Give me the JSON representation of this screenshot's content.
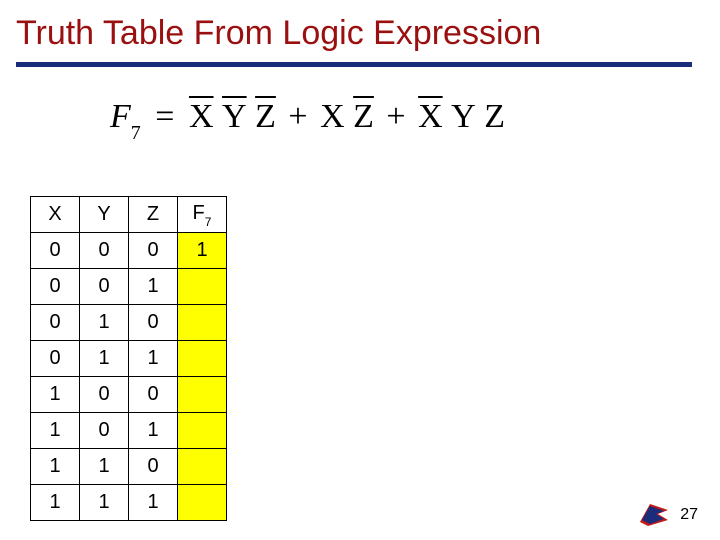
{
  "title": "Truth Table From Logic Expression",
  "equation": {
    "lhs_var": "F",
    "lhs_sub": "7",
    "eq": "=",
    "t1_a": "X",
    "t1_b": "Y",
    "t1_c": "Z",
    "plus1": "+",
    "t2_a": "X",
    "t2_b": "Z",
    "plus2": "+",
    "t3_a": "X",
    "t3_b": "Y",
    "t3_c": "Z"
  },
  "table": {
    "headers": {
      "c1": "X",
      "c2": "Y",
      "c3": "Z",
      "c4a": "F",
      "c4b": "7"
    },
    "rows": [
      {
        "x": "0",
        "y": "0",
        "z": "0",
        "f": "1"
      },
      {
        "x": "0",
        "y": "0",
        "z": "1",
        "f": ""
      },
      {
        "x": "0",
        "y": "1",
        "z": "0",
        "f": ""
      },
      {
        "x": "0",
        "y": "1",
        "z": "1",
        "f": ""
      },
      {
        "x": "1",
        "y": "0",
        "z": "0",
        "f": ""
      },
      {
        "x": "1",
        "y": "0",
        "z": "1",
        "f": ""
      },
      {
        "x": "1",
        "y": "1",
        "z": "0",
        "f": ""
      },
      {
        "x": "1",
        "y": "1",
        "z": "1",
        "f": ""
      }
    ]
  },
  "page_number": "27",
  "chart_data": {
    "type": "table",
    "title": "Truth Table From Logic Expression",
    "columns": [
      "X",
      "Y",
      "Z",
      "F7"
    ],
    "rows": [
      [
        "0",
        "0",
        "0",
        "1"
      ],
      [
        "0",
        "0",
        "1",
        ""
      ],
      [
        "0",
        "1",
        "0",
        ""
      ],
      [
        "0",
        "1",
        "1",
        ""
      ],
      [
        "1",
        "0",
        "0",
        ""
      ],
      [
        "1",
        "0",
        "1",
        ""
      ],
      [
        "1",
        "1",
        "0",
        ""
      ],
      [
        "1",
        "1",
        "1",
        ""
      ]
    ],
    "expression": "F7 = X̄ Ȳ Z̄ + X Z̄ + X̄ Y Z"
  }
}
